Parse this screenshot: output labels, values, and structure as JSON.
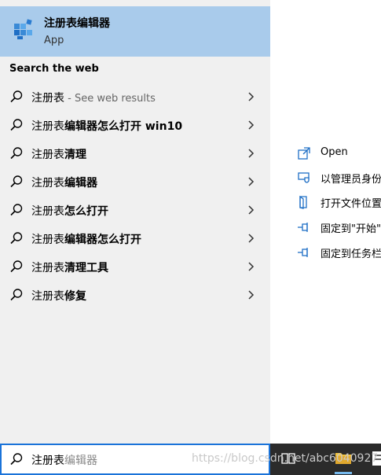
{
  "best_match": {
    "title": "注册表编辑器",
    "subtitle": "App",
    "icon": "registry-editor-icon"
  },
  "web_section": {
    "title": "Search the web",
    "suggestions": [
      {
        "bold": "",
        "plain": "注册表",
        "hint": " - See web results"
      },
      {
        "bold": "编辑器怎么打开 win10",
        "plain": "注册表",
        "hint": ""
      },
      {
        "bold": "清理",
        "plain": "注册表",
        "hint": ""
      },
      {
        "bold": "编辑器",
        "plain": "注册表",
        "hint": ""
      },
      {
        "bold": "怎么打开",
        "plain": "注册表",
        "hint": ""
      },
      {
        "bold": "编辑器怎么打开",
        "plain": "注册表",
        "hint": ""
      },
      {
        "bold": "清理工具",
        "plain": "注册表",
        "hint": ""
      },
      {
        "bold": "修复",
        "plain": "注册表",
        "hint": ""
      }
    ]
  },
  "actions": [
    {
      "label": "Open",
      "icon": "open-icon"
    },
    {
      "label": "以管理员身份",
      "icon": "run-as-admin-icon"
    },
    {
      "label": "打开文件位置",
      "icon": "file-location-icon"
    },
    {
      "label": "固定到\"开始\"",
      "icon": "pin-start-icon"
    },
    {
      "label": "固定到任务栏",
      "icon": "pin-taskbar-icon"
    }
  ],
  "search": {
    "typed": "注册表",
    "suggestion_ghost": "编辑器"
  },
  "watermark": "https://blog.csdn.net/abc6040927",
  "colors": {
    "highlight": "#a9cbeb",
    "left_bg": "#f0f0f0",
    "search_border": "#1a73d9",
    "taskbar": "#2b2b2b",
    "icon_blue": "#1f6fc5"
  }
}
